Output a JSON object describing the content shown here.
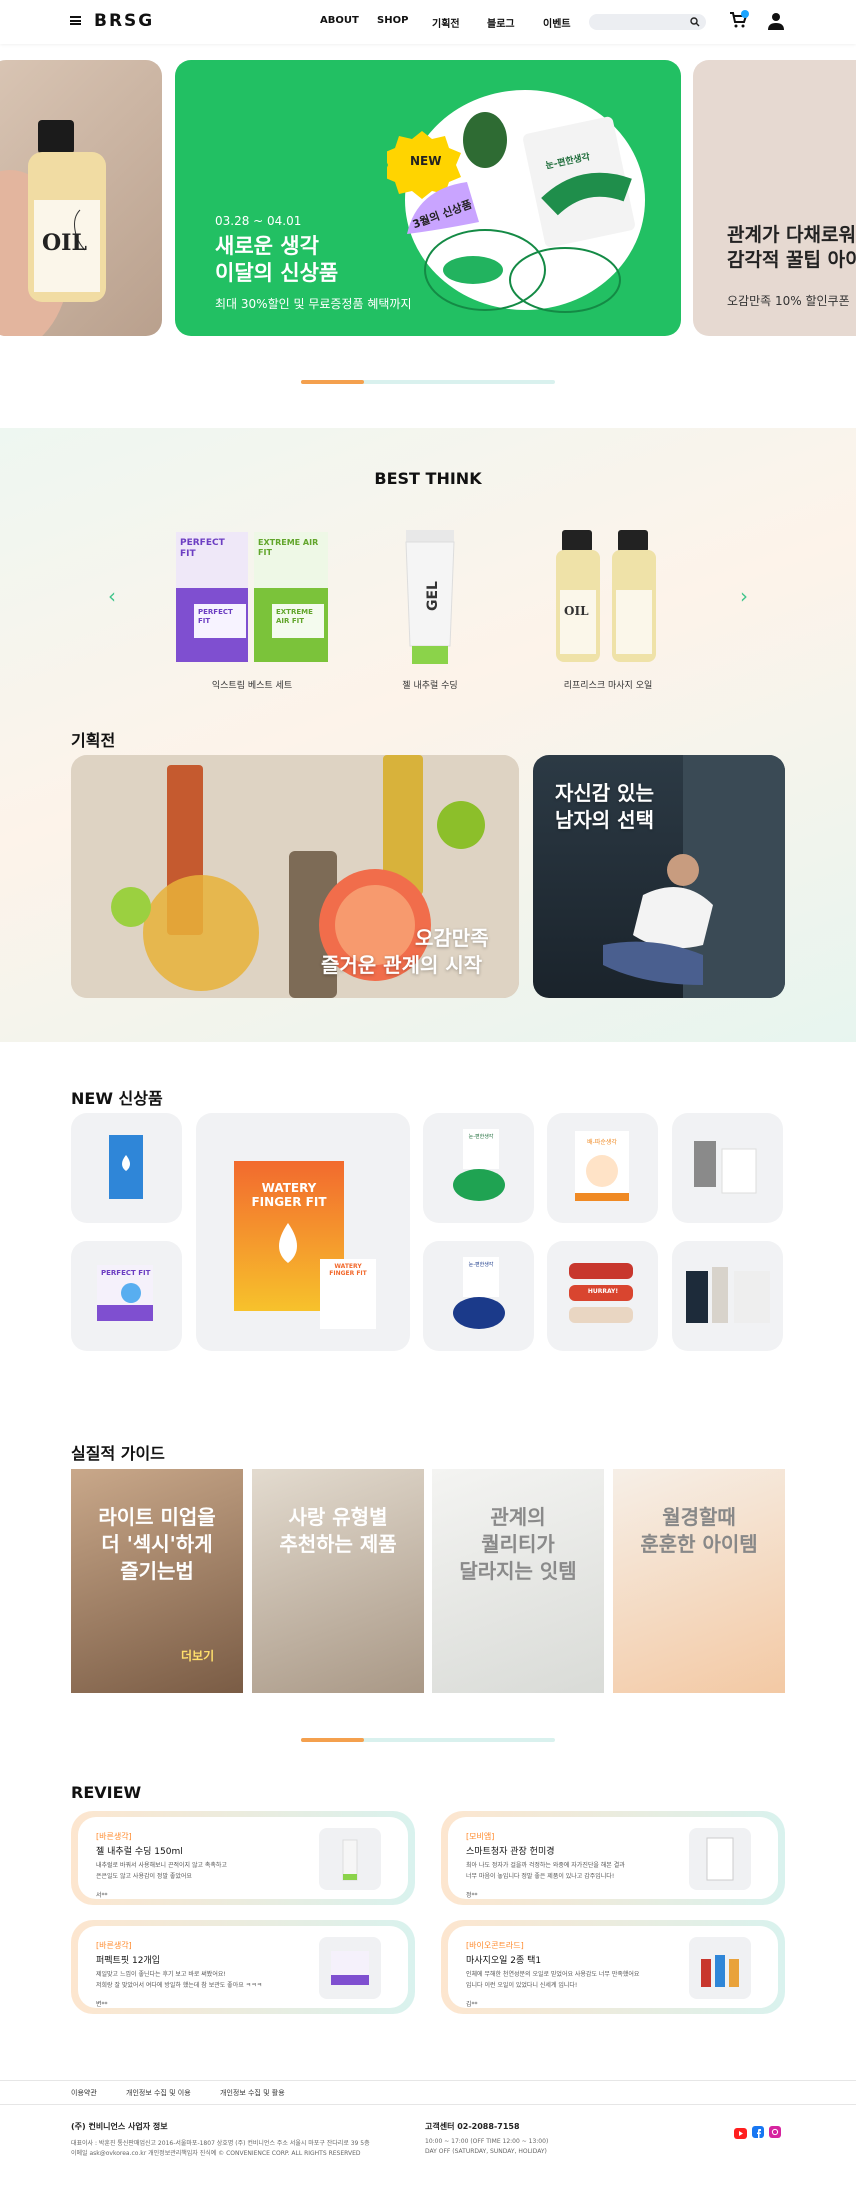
{
  "header": {
    "logo": "BRSG",
    "nav": [
      "ABOUT",
      "SHOP",
      "기획전",
      "블로그",
      "이벤트"
    ]
  },
  "hero": {
    "left_card": {
      "bottle_text": "OIL"
    },
    "main": {
      "date": "03.28 ~ 04.01",
      "title_line1": "새로운 생각",
      "title_line2": "이달의 신상품",
      "subtitle": "최대 30%할인 및 무료증정품 혜택까지",
      "badge_new": "NEW",
      "badge_month": "3월의 신상품",
      "box_label": "눈-편한생각"
    },
    "right_card": {
      "title_line1": "관계가 다채로워",
      "title_line2": "감각적 꿀팁 아이",
      "subtitle": "오감만족 10% 할인쿠폰"
    },
    "colors": {
      "accent": "#22c063",
      "pager_active": "#f4a04e",
      "pager_track": "#d9f1ee"
    }
  },
  "best": {
    "title": "BEST THINK",
    "products": [
      {
        "name": "익스트림 베스트 세트",
        "box_texts": [
          "PERFECT FIT",
          "EXTREME AIR FIT",
          "PERFECT FIT",
          "EXTREME AIR FIT"
        ]
      },
      {
        "name": "젤 내추럴 수딩",
        "tube_text": "GEL"
      },
      {
        "name": "리프리스크 마사지 오일",
        "bottle_text": "OIL"
      }
    ]
  },
  "exhibition": {
    "title": "기획전",
    "cards": [
      {
        "line1": "오감만족",
        "line2": "즐거운 관계의 시작"
      },
      {
        "line1": "자신감 있는",
        "line2": "남자의 선택"
      }
    ]
  },
  "new_products": {
    "title": "NEW 신상품",
    "featured": {
      "line1": "WATERY",
      "line2": "FINGER FIT",
      "small_box": "WATERY FINGER FIT"
    },
    "tiles": [
      {
        "label": "",
        "icon": "blue-box"
      },
      {
        "label": "눈-편한생각",
        "icon": "green-eye-mask"
      },
      {
        "label": "배-따순생각",
        "icon": "orange-patch"
      },
      {
        "label": "",
        "icon": "gray-pouch"
      },
      {
        "label": "PERFECT FIT",
        "icon": "purple-box"
      },
      {
        "label": "눈-편한생각",
        "icon": "navy-eye-mask"
      },
      {
        "label": "HURRAY!",
        "icon": "red-lip-balms"
      },
      {
        "label": "",
        "icon": "towel-set"
      }
    ]
  },
  "guide": {
    "title": "실질적 가이드",
    "cards": [
      {
        "line1": "라이트 미업을",
        "line2": "더 '섹시'하게",
        "line3": "즐기는법",
        "more": "더보기"
      },
      {
        "line1": "사랑 유형별",
        "line2": "추천하는 제품",
        "line3": ""
      },
      {
        "line1": "관계의",
        "line2": "퀄리티가",
        "line3": "달라지는 잇템"
      },
      {
        "line1": "월경할때",
        "line2": "훈훈한 아이템",
        "line3": ""
      }
    ]
  },
  "review": {
    "title": "REVIEW",
    "items": [
      {
        "category": "[바른생각]",
        "product": "젤 내추럴 수딩 150ml",
        "body1": "내추럴로 바꿔서 사용해보니 끈적이지 않고 촉촉하고",
        "body2": "은은일도 않고 사용감이 정말 좋았어요",
        "user": "서**"
      },
      {
        "category": "[모비앱]",
        "product": "스마트청자 관장 헌미경",
        "body1": "최아 나도 정자가 걸을까 걱정하는 와중에 자가진단을 해본 결과",
        "body2": "너무 마음이 놓입니다 정말 좋은 제품이 있나고 감주입니다!",
        "user": "정**"
      },
      {
        "category": "[바른생각]",
        "product": "퍼펙트핏 12개입",
        "body1": "제일맞고 느낌이 좋닌다는 후기 보고 바로 써봤어요!",
        "body2": "저희랑 잘 맞았어서 여다에 방일하 했는데 참 보관도 좋아요 ㅋㅋㅋ",
        "user": "변**"
      },
      {
        "category": "[바이오콘트라드]",
        "product": "마사지오일 2종 택1",
        "body1": "인체에 무해한 천연성분의 오일로 믿었어요 사용감도 너무 만족했어요",
        "body2": "입니다 이런 오일이 있었다니 신세계 입니다!",
        "user": "김**"
      }
    ]
  },
  "footer": {
    "links": [
      "이용약관",
      "개인정보 수집 및 이용",
      "개인정보 수집 및 활용"
    ],
    "company_title": "(주) 컨비니언스 사업자 정보",
    "company_line1": "대표이사 : 박훈진    통신판매업신고 2016-서울마포-1807    상호명 (주) 컨비니언스    주소 서울시 마포구 잔다리로 39 5층",
    "company_line2": "이메일 ask@ovkorea.co.kr    개인정보관리책임자 진식예    © CONVENIENCE CORP. ALL RIGHTS RESERVED",
    "cs_title": "고객센터 02-2088-7158",
    "cs_line1": "10:00 ~ 17:00 (OFF TIME 12:00 ~ 13:00)",
    "cs_line2": "DAY OFF (SATURDAY, SUNDAY, HOLIDAY)",
    "social": [
      "youtube-icon",
      "facebook-icon",
      "instagram-icon"
    ]
  }
}
